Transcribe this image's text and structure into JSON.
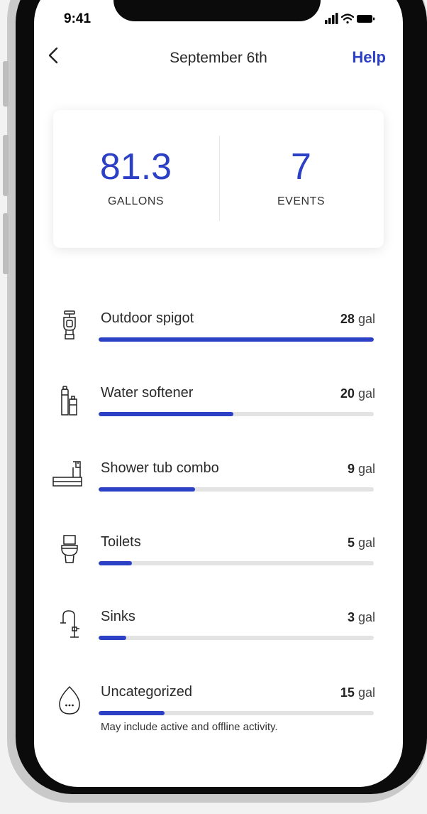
{
  "status_bar": {
    "time": "9:41"
  },
  "nav": {
    "title": "September 6th",
    "help_label": "Help"
  },
  "summary": {
    "gallons_value": "81.3",
    "gallons_label": "GALLONS",
    "events_value": "7",
    "events_label": "EVENTS"
  },
  "usage_items": [
    {
      "name": "Outdoor spigot",
      "amount": "28",
      "unit": "gal",
      "icon": "spigot-icon",
      "fill_fraction": 1.0
    },
    {
      "name": "Water softener",
      "amount": "20",
      "unit": "gal",
      "icon": "water-softener-icon",
      "fill_fraction": 0.49
    },
    {
      "name": "Shower tub combo",
      "amount": "9",
      "unit": "gal",
      "icon": "shower-tub-icon",
      "fill_fraction": 0.35
    },
    {
      "name": "Toilets",
      "amount": "5",
      "unit": "gal",
      "icon": "toilet-icon",
      "fill_fraction": 0.12
    },
    {
      "name": "Sinks",
      "amount": "3",
      "unit": "gal",
      "icon": "sink-faucet-icon",
      "fill_fraction": 0.1
    },
    {
      "name": "Uncategorized",
      "amount": "15",
      "unit": "gal",
      "icon": "water-drop-more-icon",
      "fill_fraction": 0.24,
      "note": "May include active and offline activity."
    }
  ],
  "colors": {
    "accent": "#2b40c4",
    "track": "#e3e3e3"
  }
}
